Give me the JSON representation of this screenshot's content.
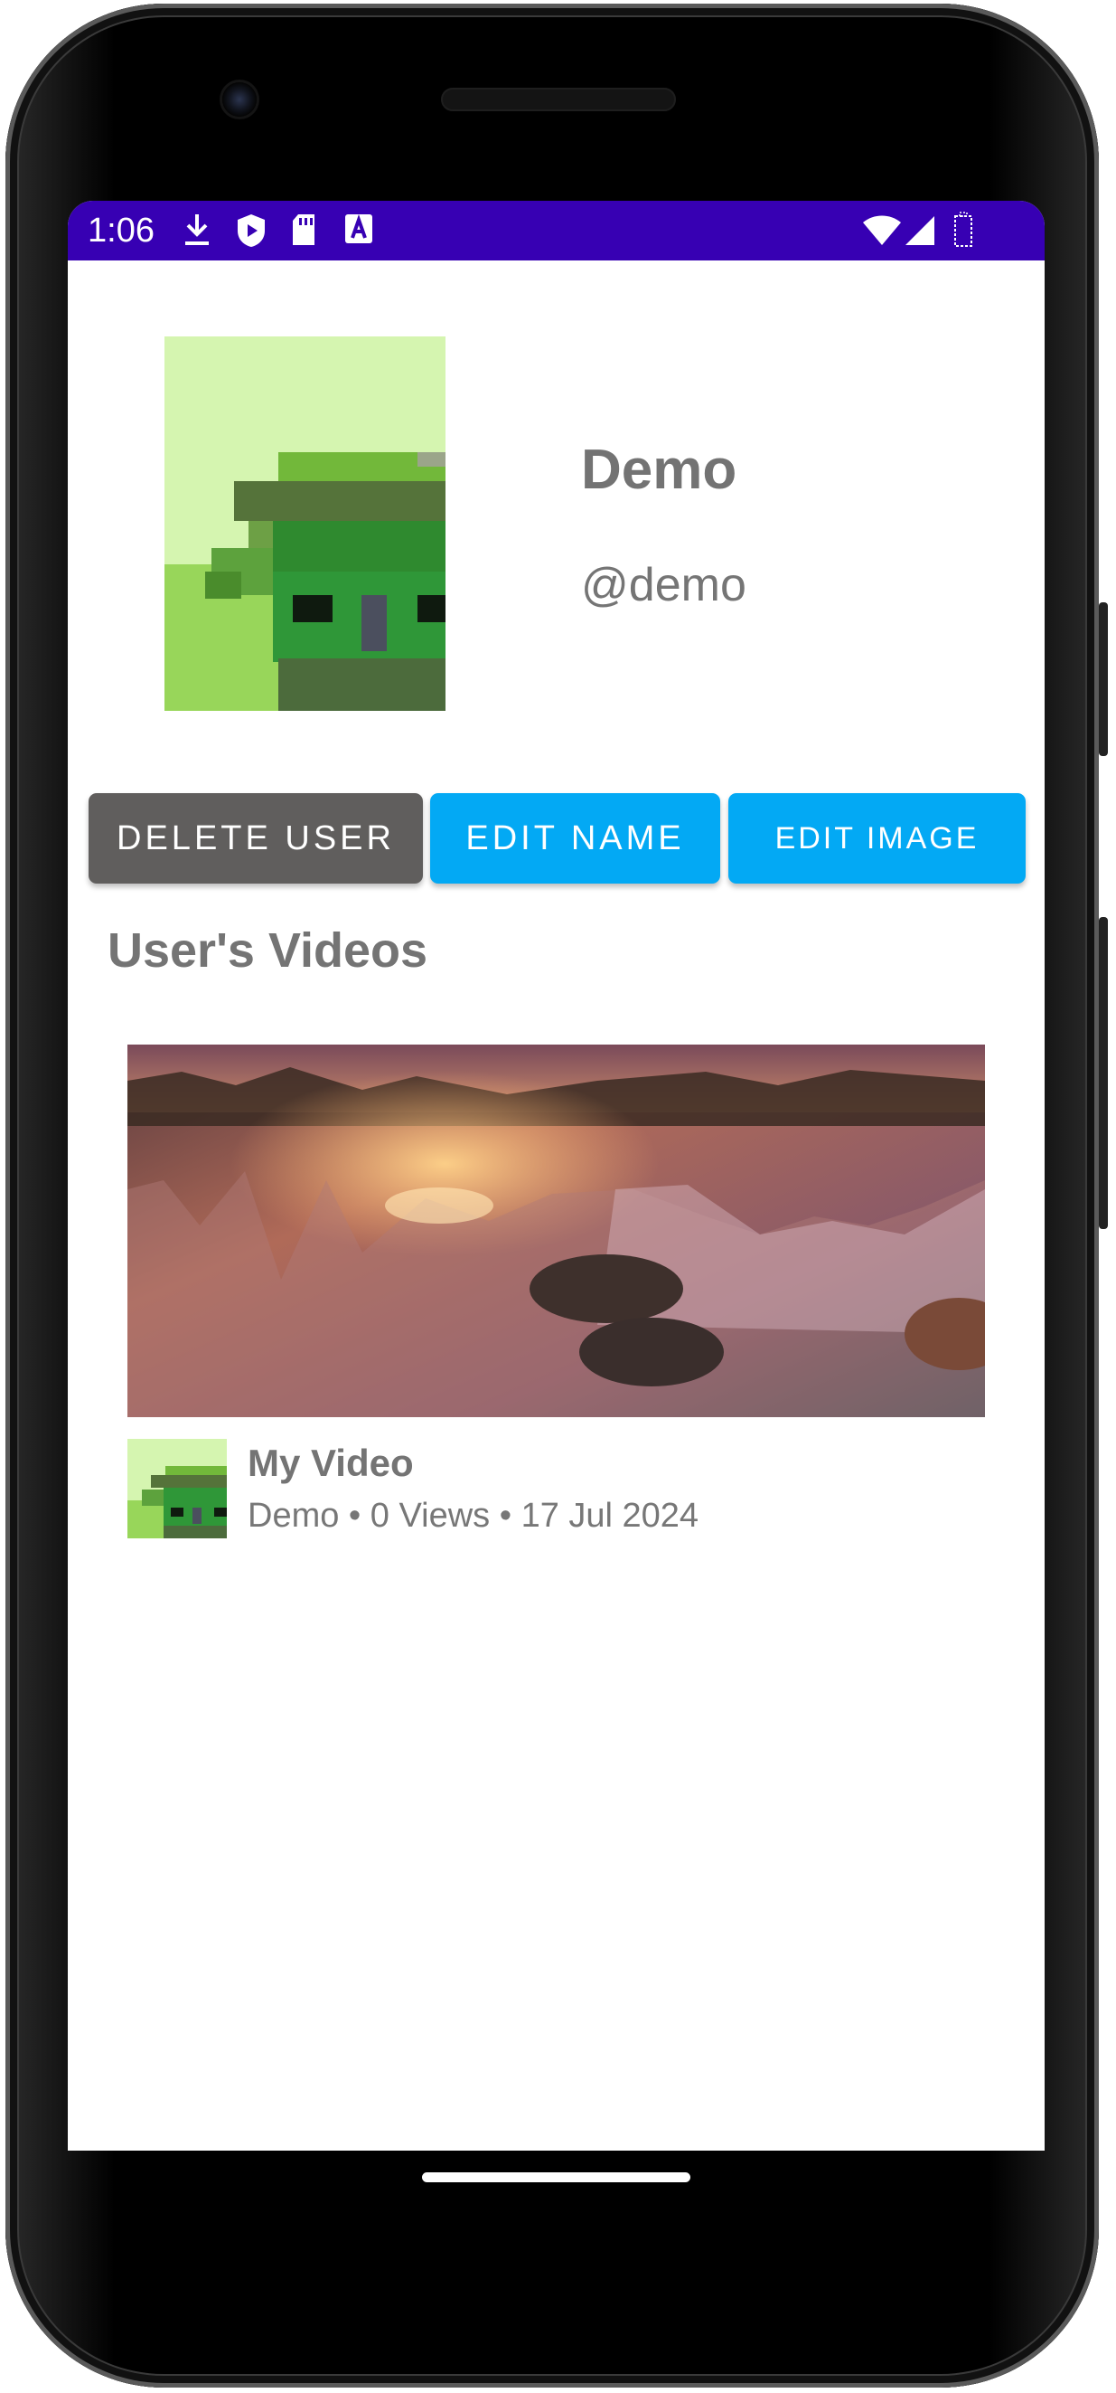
{
  "status_bar": {
    "time": "1:06",
    "left_icons": [
      "download-icon",
      "play-protect-icon",
      "sd-card-icon",
      "accessibility-a-icon"
    ],
    "right_icons": [
      "wifi-icon",
      "cell-signal-icon",
      "battery-icon"
    ],
    "color": "#3700b3"
  },
  "profile": {
    "name": "Demo",
    "handle": "@demo",
    "avatar_icon": "pixel-avatar-icon"
  },
  "actions": {
    "delete_label": "DELETE USER",
    "edit_name_label": "EDIT NAME",
    "edit_image_label": "EDIT IMAGE",
    "delete_color": "#605e5d",
    "edit_color": "#03a9f4"
  },
  "videos": {
    "section_title": "User's Videos",
    "items": [
      {
        "title": "My Video",
        "meta": "Demo • 0 Views • 17 Jul 2024",
        "thumbnail": "sunset-lake-thumbnail"
      }
    ]
  }
}
